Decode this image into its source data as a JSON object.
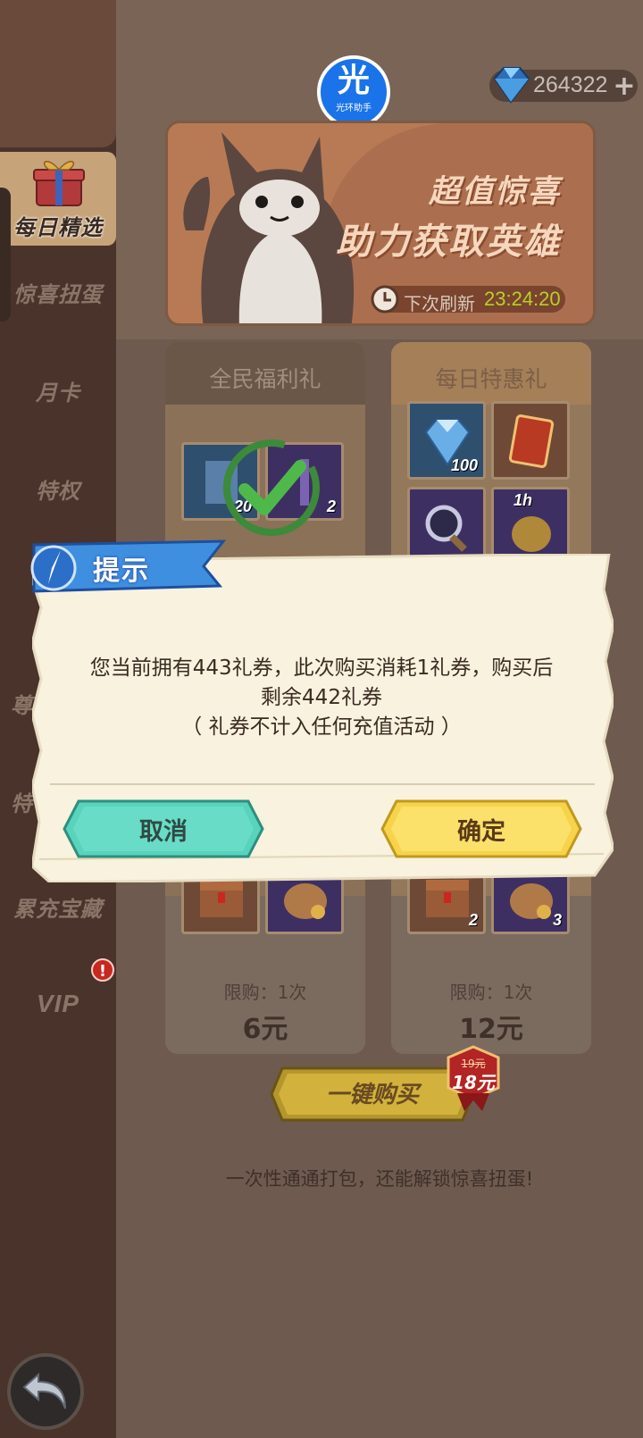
{
  "sidebar": {
    "items": [
      {
        "label": "每日精选",
        "active": true
      },
      {
        "label": "惊喜扭蛋"
      },
      {
        "label": "月卡"
      },
      {
        "label": "特权"
      },
      {
        "label": "尊"
      },
      {
        "label": "特"
      },
      {
        "label": "累充宝藏"
      },
      {
        "label": "VIP"
      }
    ],
    "vip_badge": "!"
  },
  "header": {
    "logo_mark": "光",
    "logo_text": "光环助手",
    "gem_count": "264322",
    "plus_symbol": "+"
  },
  "banner": {
    "title_line1": "超值惊喜",
    "title_line2": "助力获取英雄",
    "refresh_label": "下次刷新",
    "refresh_time": "23:24:20"
  },
  "cards": [
    {
      "title": "全民福利礼",
      "tile_counts": [
        "20",
        "2"
      ],
      "bottom_tile_counts": [
        "",
        ""
      ],
      "limit": "限购：1次",
      "price": "6元",
      "claimed": true
    },
    {
      "title": "每日特惠礼",
      "tile_counts": [
        "100",
        "",
        "",
        "1h"
      ],
      "bottom_tile_counts": [
        "2",
        "3"
      ],
      "limit": "限购：1次",
      "price": "12元"
    }
  ],
  "buy_all": {
    "label": "一键购买",
    "old_price": "19元",
    "new_price": "18元"
  },
  "footer_note": "一次性通通打包，还能解锁惊喜扭蛋!",
  "dialog": {
    "title": "提示",
    "message_line1": "您当前拥有443礼券，此次购买消耗1礼券，购买后",
    "message_line2": "剩余442礼券",
    "message_line3": "（ 礼券不计入任何充值活动 ）",
    "cancel_label": "取消",
    "confirm_label": "确定"
  },
  "colors": {
    "cancel_button": "#58d3bc",
    "confirm_button": "#f7d34a",
    "dialog_paper": "#faf5e0",
    "ribbon": "#3f8fe0"
  }
}
